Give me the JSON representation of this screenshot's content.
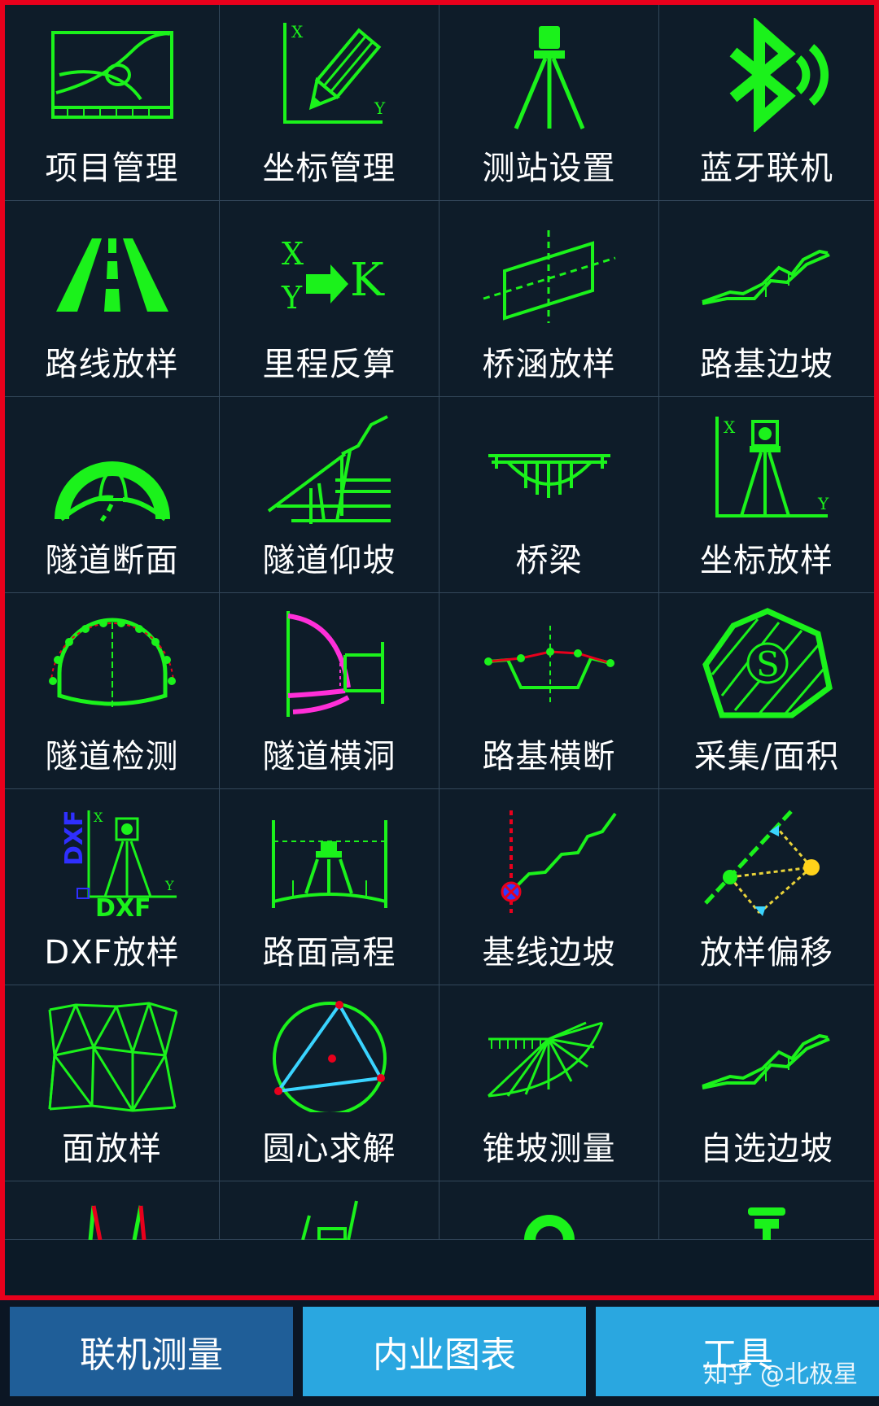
{
  "menu": {
    "items": [
      {
        "label": "项目管理",
        "icon": "project-chart-icon"
      },
      {
        "label": "坐标管理",
        "icon": "coordinate-pencil-icon"
      },
      {
        "label": "测站设置",
        "icon": "total-station-tripod-icon"
      },
      {
        "label": "蓝牙联机",
        "icon": "bluetooth-icon"
      },
      {
        "label": "路线放样",
        "icon": "road-icon"
      },
      {
        "label": "里程反算",
        "icon": "xy-to-k-icon"
      },
      {
        "label": "桥涵放样",
        "icon": "culvert-parallelogram-icon"
      },
      {
        "label": "路基边坡",
        "icon": "subgrade-slope-icon"
      },
      {
        "label": "隧道断面",
        "icon": "tunnel-section-icon"
      },
      {
        "label": "隧道仰坡",
        "icon": "tunnel-slope-icon"
      },
      {
        "label": "桥梁",
        "icon": "bridge-icon"
      },
      {
        "label": "坐标放样",
        "icon": "coordinate-stakeout-icon"
      },
      {
        "label": "隧道检测",
        "icon": "tunnel-inspection-icon"
      },
      {
        "label": "隧道横洞",
        "icon": "tunnel-crossing-icon"
      },
      {
        "label": "路基横断",
        "icon": "subgrade-cross-section-icon"
      },
      {
        "label": "采集/面积",
        "icon": "area-hexagon-icon"
      },
      {
        "label": "DXF放样",
        "icon": "dxf-stakeout-icon"
      },
      {
        "label": "路面高程",
        "icon": "pavement-elevation-icon"
      },
      {
        "label": "基线边坡",
        "icon": "baseline-slope-icon"
      },
      {
        "label": "放样偏移",
        "icon": "stakeout-offset-icon"
      },
      {
        "label": "面放样",
        "icon": "triangle-mesh-icon"
      },
      {
        "label": "圆心求解",
        "icon": "circle-center-icon"
      },
      {
        "label": "锥坡测量",
        "icon": "cone-slope-icon"
      },
      {
        "label": "自选边坡",
        "icon": "custom-slope-icon"
      }
    ],
    "partial_icons": [
      "antenna-pair-icon",
      "level-staff-icon",
      "ring-icon",
      "gnss-receiver-icon"
    ],
    "dxf_text": "DXF",
    "axis_x": "X",
    "axis_y": "Y",
    "k_text": "K",
    "s_text": "S"
  },
  "tabs": [
    {
      "label": "联机测量",
      "active": true
    },
    {
      "label": "内业图表",
      "active": false
    },
    {
      "label": "工具",
      "active": false
    }
  ],
  "watermark": "知乎 @北极星",
  "colors": {
    "icon_green": "#1bf21b",
    "frame_red": "#e8001c",
    "tab_active": "#1f5e98",
    "tab_inactive": "#2aa7e0"
  }
}
